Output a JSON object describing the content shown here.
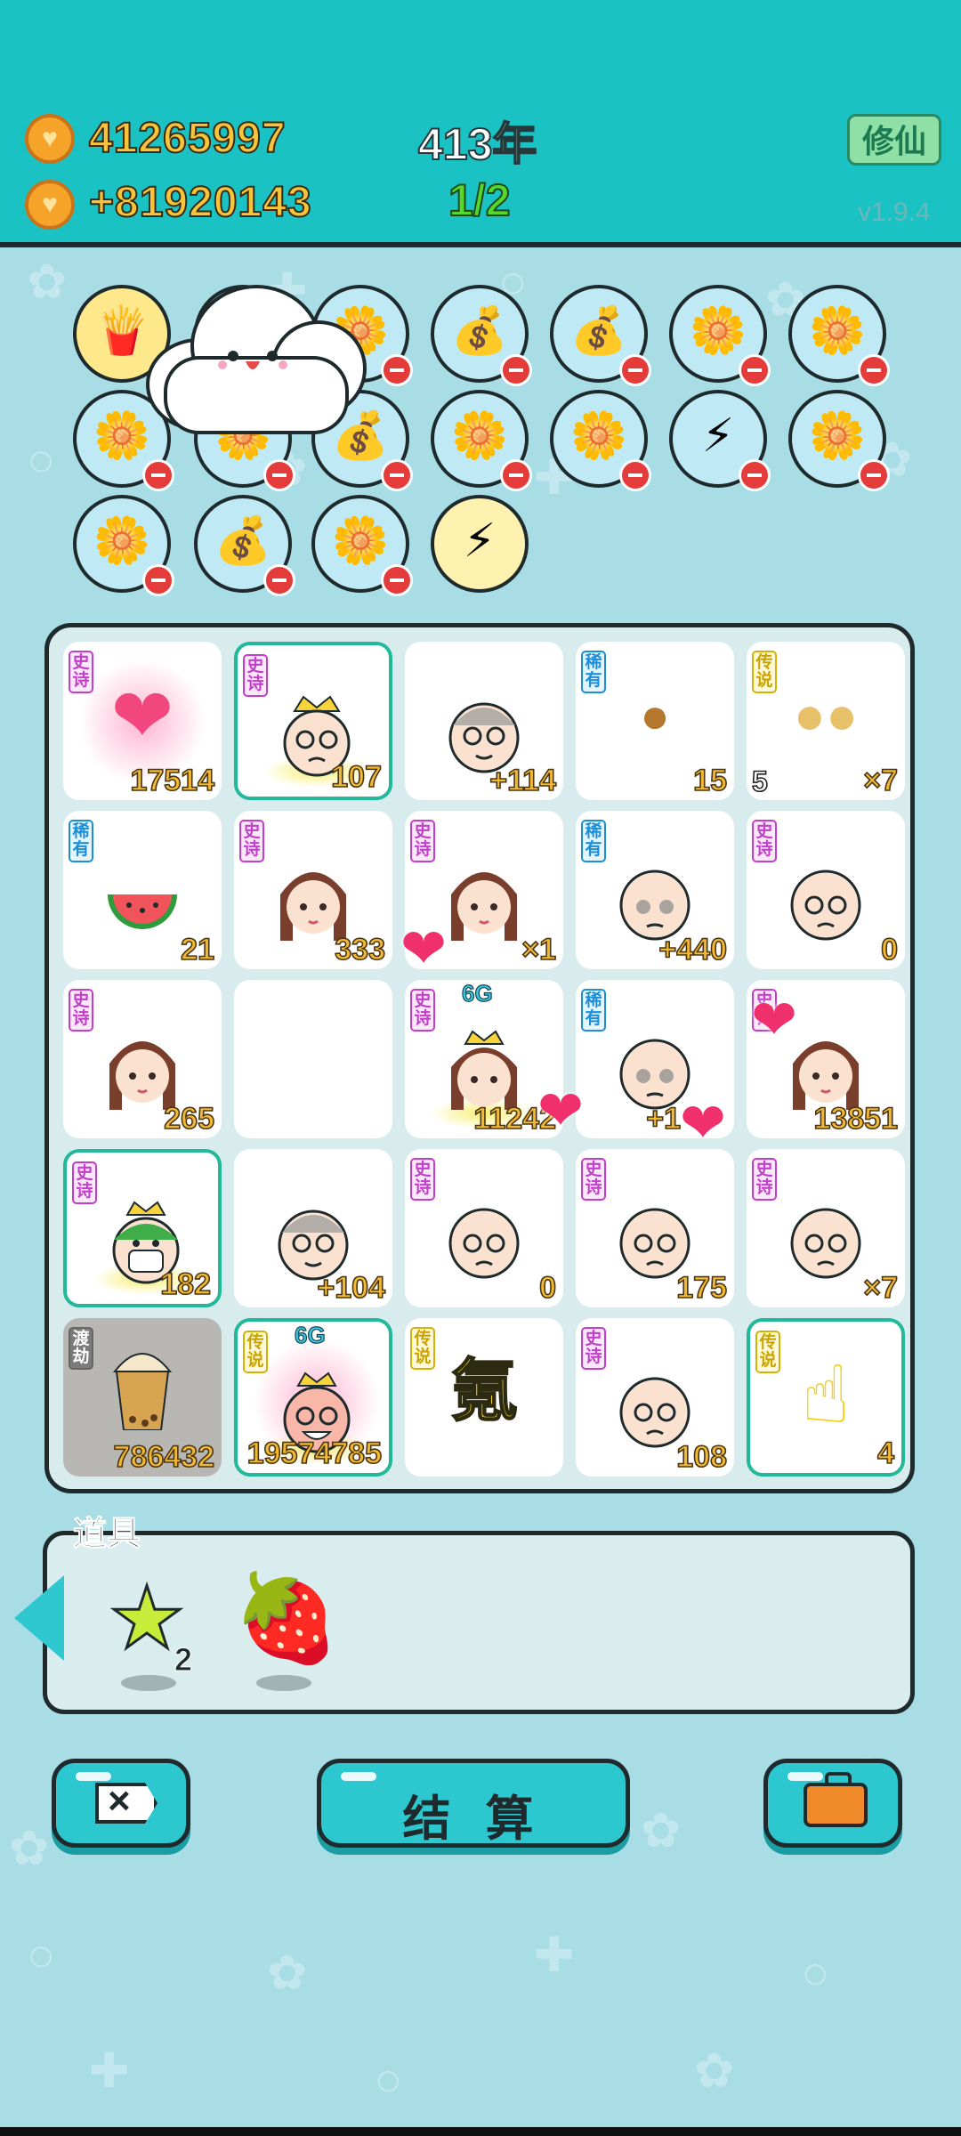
{
  "header": {
    "coins": "41265997",
    "coins_rate": "+81920143",
    "year": "413年",
    "fraction": "1/2",
    "cultivate_label": "修仙",
    "version": "v1.9.4"
  },
  "queue_icons": [
    "fries-icon",
    "flower-pot-icon",
    "flower-pot-icon",
    "money-bag-icon",
    "money-bag-icon",
    "flower-pot-icon",
    "flower-pot-icon",
    "flower-pot-icon",
    "flower-pot-icon",
    "money-bag-icon",
    "flower-pot-icon",
    "flower-pot-icon",
    "flower-pot-icon",
    "flower-pot-icon",
    "flower-pot-icon",
    "money-bag-icon",
    "flower-pot-icon",
    "lightning-icon"
  ],
  "board": [
    {
      "rarity": "史诗",
      "icon": "heart-icon",
      "value": "17514"
    },
    {
      "rarity": "史诗",
      "icon": "crowned-face-icon",
      "value": "107"
    },
    {
      "rarity": "",
      "icon": "old-man-face-icon",
      "value": "+114"
    },
    {
      "rarity": "稀有",
      "icon": "nut-icon",
      "value": "15"
    },
    {
      "rarity": "传说",
      "icon": "longan-icon",
      "value": "×7",
      "left_value": "5"
    },
    {
      "rarity": "稀有",
      "icon": "watermelon-icon",
      "value": "21"
    },
    {
      "rarity": "史诗",
      "icon": "girl-face-icon",
      "value": "333"
    },
    {
      "rarity": "史诗",
      "icon": "girl-face-icon",
      "value": "×1"
    },
    {
      "rarity": "稀有",
      "icon": "bald-face-icon",
      "value": "+440"
    },
    {
      "rarity": "史诗",
      "icon": "bald-face-icon",
      "value": "0"
    },
    {
      "rarity": "史诗",
      "icon": "girl-face-icon",
      "value": "265"
    },
    {
      "rarity": "",
      "icon": "",
      "value": ""
    },
    {
      "rarity": "史诗",
      "icon": "crowned-girl-icon",
      "value": "11242",
      "tag": "6G"
    },
    {
      "rarity": "稀有",
      "icon": "bald-face-icon",
      "value": "+1"
    },
    {
      "rarity": "史诗",
      "icon": "girl-face-icon",
      "value": "13851"
    },
    {
      "rarity": "史诗",
      "icon": "masked-king-icon",
      "value": "182"
    },
    {
      "rarity": "",
      "icon": "old-man-face-icon",
      "value": "+104"
    },
    {
      "rarity": "史诗",
      "icon": "bald-face-icon",
      "value": "0"
    },
    {
      "rarity": "史诗",
      "icon": "bald-face-icon",
      "value": "175"
    },
    {
      "rarity": "史诗",
      "icon": "bald-face-icon",
      "value": "×7"
    },
    {
      "rarity": "渡劫",
      "icon": "milk-tea-icon",
      "value": "786432"
    },
    {
      "rarity": "传说",
      "icon": "crowned-laughing-icon",
      "value": "19574785",
      "tag": "6G"
    },
    {
      "rarity": "传说",
      "icon": "",
      "value": "",
      "center_text": "氪"
    },
    {
      "rarity": "史诗",
      "icon": "bald-face-icon",
      "value": "108"
    },
    {
      "rarity": "传说",
      "icon": "pointing-hand-icon",
      "value": "4"
    }
  ],
  "tools": {
    "title": "道具",
    "items": [
      {
        "icon": "star-icon",
        "count": "2"
      },
      {
        "icon": "strawberry-icon",
        "count": ""
      }
    ]
  },
  "buttons": {
    "settle_label": "结 算"
  },
  "colors": {
    "header_bg": "#1bc2c4",
    "page_bg": "#a9dde6",
    "gold": "#f2b933",
    "epic": "#c23ecb",
    "rare": "#1c8fd8",
    "legend": "#d3b20b"
  }
}
